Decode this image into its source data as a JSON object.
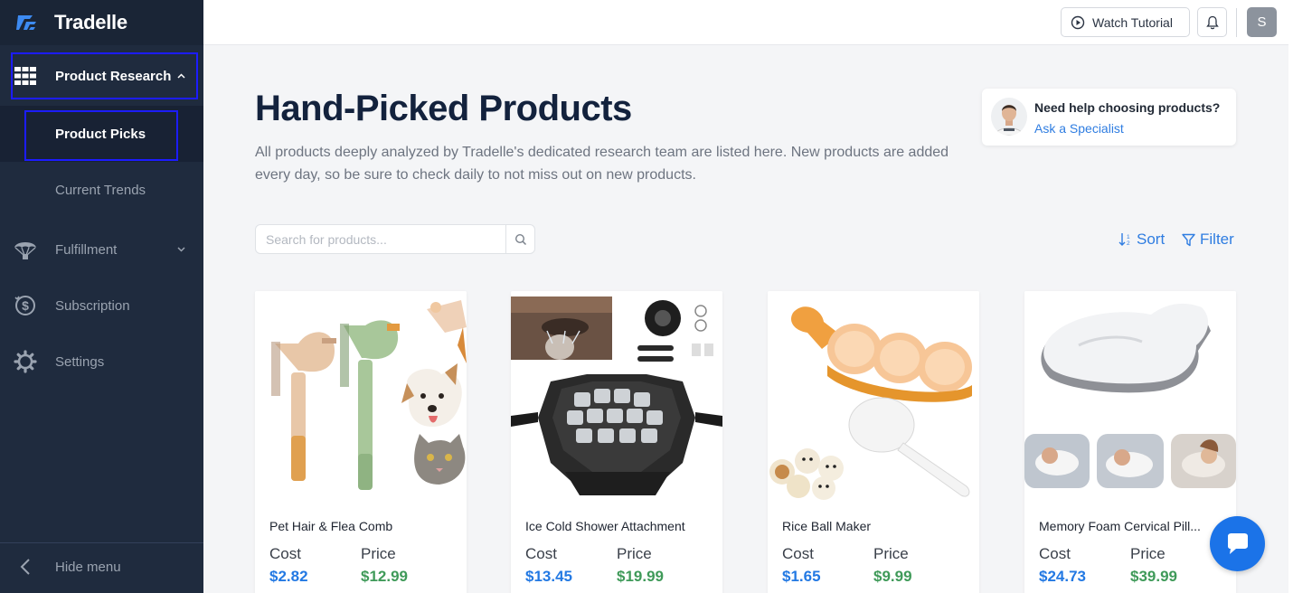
{
  "brand": {
    "name": "Tradelle"
  },
  "sidebar": {
    "product_research": "Product Research",
    "product_picks": "Product Picks",
    "current_trends": "Current Trends",
    "fulfillment": "Fulfillment",
    "subscription": "Subscription",
    "settings": "Settings",
    "hide_menu": "Hide menu"
  },
  "topbar": {
    "watch_tutorial": "Watch Tutorial",
    "avatar_initial": "S"
  },
  "main": {
    "title": "Hand-Picked Products",
    "description": "All products deeply analyzed by Tradelle's dedicated research team are listed here. New products are added every day, so be sure to check daily to not miss out on new products.",
    "search_placeholder": "Search for products...",
    "sort_label": "Sort",
    "filter_label": "Filter"
  },
  "help": {
    "title": "Need help choosing products?",
    "link": "Ask a Specialist"
  },
  "products": [
    {
      "name": "Pet Hair & Flea Comb",
      "cost_label": "Cost",
      "price_label": "Price",
      "cost": "$2.82",
      "price": "$12.99"
    },
    {
      "name": "Ice Cold Shower Attachment",
      "cost_label": "Cost",
      "price_label": "Price",
      "cost": "$13.45",
      "price": "$19.99"
    },
    {
      "name": "Rice Ball Maker",
      "cost_label": "Cost",
      "price_label": "Price",
      "cost": "$1.65",
      "price": "$9.99"
    },
    {
      "name": "Memory Foam Cervical Pill...",
      "cost_label": "Cost",
      "price_label": "Price",
      "cost": "$24.73",
      "price": "$39.99"
    }
  ],
  "colors": {
    "sidebar": "#1f2b3e",
    "accent": "#2f7de1",
    "cost": "#2379e3",
    "price": "#3f9a59",
    "title": "#13223d"
  }
}
